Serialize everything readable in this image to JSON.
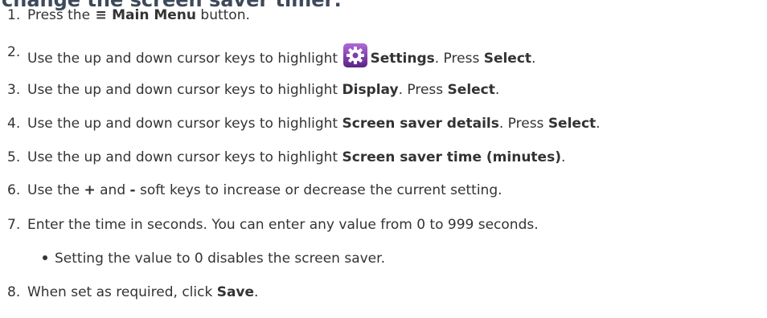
{
  "heading": "change the screen saver timer:",
  "steps": [
    {
      "num": "1.",
      "pre": "Press the ",
      "icon": "hamburger-menu-icon",
      "icon_glyph": "≡",
      "bold": "Main Menu",
      "post": " button."
    },
    {
      "num": "2.",
      "pre": "Use the up and down cursor keys to highlight ",
      "icon": "settings-gear-icon",
      "bold": "Settings",
      "mid": ". Press ",
      "bold2": "Select",
      "post": "."
    },
    {
      "num": "3.",
      "pre": "Use the up and down cursor keys to highlight ",
      "bold": "Display",
      "mid": ". Press ",
      "bold2": "Select",
      "post": "."
    },
    {
      "num": "4.",
      "pre": "Use the up and down cursor keys to highlight ",
      "bold": "Screen saver details",
      "mid": ". Press ",
      "bold2": "Select",
      "post": "."
    },
    {
      "num": "5.",
      "pre": "Use the up and down cursor keys to highlight ",
      "bold": "Screen saver time (minutes)",
      "post": "."
    },
    {
      "num": "6.",
      "pre": "Use the ",
      "bold": "+",
      "mid": " and ",
      "bold2": "-",
      "post": " soft keys to increase or decrease the current setting."
    },
    {
      "num": "7.",
      "pre": "Enter the time in seconds. You can enter any value from 0 to 999 seconds.",
      "bullet": "Setting the value to 0 disables the screen saver."
    },
    {
      "num": "8.",
      "pre": "When set as required, click ",
      "bold": "Save",
      "post": "."
    }
  ],
  "colors": {
    "text": "#333333",
    "heading": "#3c4a5a",
    "settings_icon_bg": "#7b3fa8"
  }
}
